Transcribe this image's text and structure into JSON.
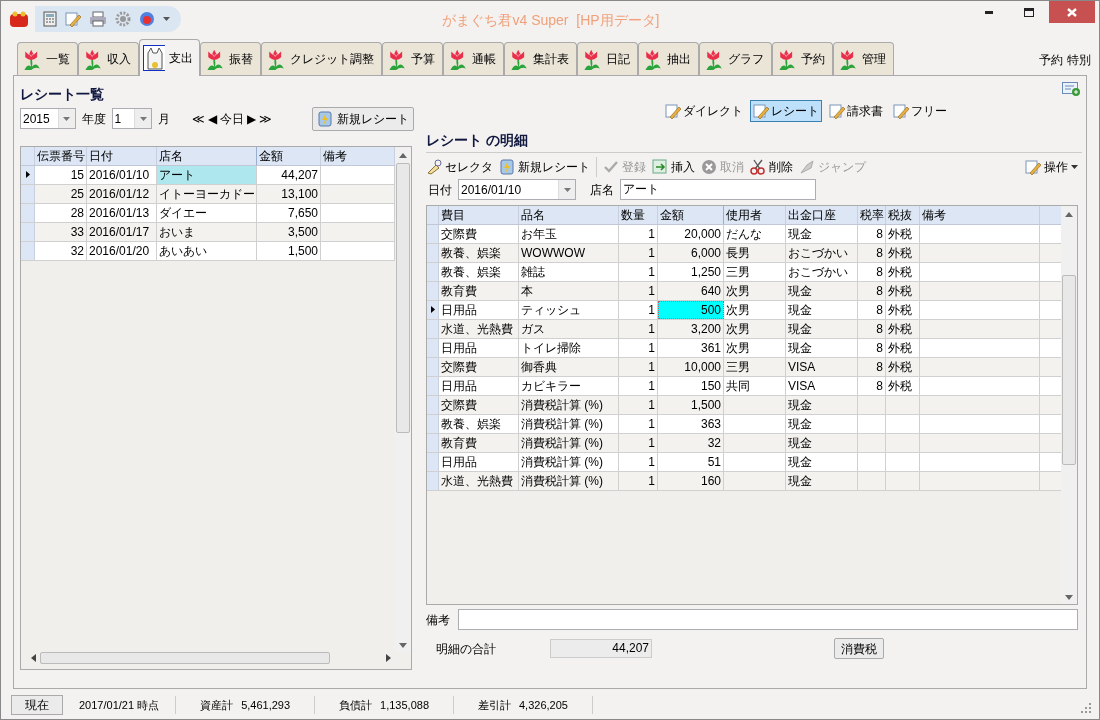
{
  "window": {
    "title": "がまぐち君v4 Super  [HP用データ]"
  },
  "tabs": [
    {
      "label": "一覧",
      "selected": false
    },
    {
      "label": "収入",
      "selected": false
    },
    {
      "label": "支出",
      "selected": true
    },
    {
      "label": "振替",
      "selected": false
    },
    {
      "label": "クレジット調整",
      "selected": false
    },
    {
      "label": "予算",
      "selected": false
    },
    {
      "label": "通帳",
      "selected": false
    },
    {
      "label": "集計表",
      "selected": false
    },
    {
      "label": "日記",
      "selected": false
    },
    {
      "label": "抽出",
      "selected": false
    },
    {
      "label": "グラフ",
      "selected": false
    },
    {
      "label": "予約",
      "selected": false
    },
    {
      "label": "管理",
      "selected": false
    }
  ],
  "side_links": [
    "予約",
    "特別"
  ],
  "receipt_list": {
    "title": "レシート一覧",
    "year": "2015",
    "year_label": "年度",
    "month": "1",
    "month_label": "月",
    "nav": [
      "≪",
      "◀",
      "今日",
      "▶",
      "≫"
    ],
    "new_button": "新規レシート",
    "columns": [
      {
        "label": "伝票番号",
        "kind": "number",
        "focused": false
      },
      {
        "label": "日付",
        "kind": "text",
        "focused": false
      },
      {
        "label": "店名",
        "kind": "text",
        "focused": true
      },
      {
        "label": "金額",
        "kind": "number",
        "focused": false
      },
      {
        "label": "備考",
        "kind": "text",
        "focused": false
      }
    ],
    "rows": [
      {
        "selected": true,
        "cells": [
          "15",
          "2016/01/10",
          "アート",
          "44,207",
          ""
        ]
      },
      {
        "selected": false,
        "cells": [
          "25",
          "2016/01/12",
          "イトーヨーカドー",
          "13,100",
          ""
        ]
      },
      {
        "selected": false,
        "cells": [
          "28",
          "2016/01/13",
          "ダイエー",
          "7,650",
          ""
        ]
      },
      {
        "selected": false,
        "cells": [
          "33",
          "2016/01/17",
          "おいま",
          "3,500",
          ""
        ]
      },
      {
        "selected": false,
        "cells": [
          "32",
          "2016/01/20",
          "あいあい",
          "1,500",
          ""
        ]
      }
    ]
  },
  "view_buttons": [
    {
      "label": "ダイレクト",
      "selected": false
    },
    {
      "label": "レシート",
      "selected": true
    },
    {
      "label": "請求書",
      "selected": false
    },
    {
      "label": "フリー",
      "selected": false
    }
  ],
  "detail": {
    "title": "レシート の明細",
    "toolbar": [
      {
        "label": "セレクタ",
        "disabled": false
      },
      {
        "label": "新規レシート",
        "disabled": false
      },
      {
        "label": "登録",
        "disabled": true
      },
      {
        "label": "挿入",
        "disabled": false
      },
      {
        "label": "取消",
        "disabled": true
      },
      {
        "label": "削除",
        "disabled": false
      },
      {
        "label": "ジャンプ",
        "disabled": true
      }
    ],
    "operations_menu": "操作",
    "date_label": "日付",
    "date": "2016/01/10",
    "store_label": "店名",
    "store": "アート",
    "columns": [
      {
        "label": "費目",
        "kind": "text",
        "focused": false
      },
      {
        "label": "品名",
        "kind": "text",
        "focused": false
      },
      {
        "label": "数量",
        "kind": "number",
        "focused": false
      },
      {
        "label": "金額",
        "kind": "number",
        "focused": true
      },
      {
        "label": "使用者",
        "kind": "text",
        "focused": false
      },
      {
        "label": "出金口座",
        "kind": "text",
        "focused": false
      },
      {
        "label": "税率",
        "kind": "number",
        "focused": false
      },
      {
        "label": "税抜",
        "kind": "text",
        "focused": false
      },
      {
        "label": "備考",
        "kind": "text",
        "focused": false
      }
    ],
    "rows": [
      {
        "selected": false,
        "cells": [
          "交際費",
          "お年玉",
          "1",
          "20,000",
          "だんな",
          "現金",
          "8",
          "外税",
          ""
        ]
      },
      {
        "selected": false,
        "cells": [
          "教養、娯楽",
          "WOWWOW",
          "1",
          "6,000",
          "長男",
          "おこづかい",
          "8",
          "外税",
          ""
        ]
      },
      {
        "selected": false,
        "cells": [
          "教養、娯楽",
          "雑誌",
          "1",
          "1,250",
          "三男",
          "おこづかい",
          "8",
          "外税",
          ""
        ]
      },
      {
        "selected": false,
        "cells": [
          "教育費",
          "本",
          "1",
          "640",
          "次男",
          "現金",
          "8",
          "外税",
          ""
        ]
      },
      {
        "selected": true,
        "cells": [
          "日用品",
          "ティッシュ",
          "1",
          "500",
          "次男",
          "現金",
          "8",
          "外税",
          ""
        ]
      },
      {
        "selected": false,
        "cells": [
          "水道、光熱費",
          "ガス",
          "1",
          "3,200",
          "次男",
          "現金",
          "8",
          "外税",
          ""
        ]
      },
      {
        "selected": false,
        "cells": [
          "日用品",
          "トイレ掃除",
          "1",
          "361",
          "次男",
          "現金",
          "8",
          "外税",
          ""
        ]
      },
      {
        "selected": false,
        "cells": [
          "交際費",
          "御香典",
          "1",
          "10,000",
          "三男",
          "VISA",
          "8",
          "外税",
          ""
        ]
      },
      {
        "selected": false,
        "cells": [
          "日用品",
          "カビキラー",
          "1",
          "150",
          "共同",
          "VISA",
          "8",
          "外税",
          ""
        ]
      },
      {
        "selected": false,
        "cells": [
          "交際費",
          "消費税計算 (%)",
          "1",
          "1,500",
          "",
          "現金",
          "",
          "",
          ""
        ]
      },
      {
        "selected": false,
        "cells": [
          "教養、娯楽",
          "消費税計算 (%)",
          "1",
          "363",
          "",
          "現金",
          "",
          "",
          ""
        ]
      },
      {
        "selected": false,
        "cells": [
          "教育費",
          "消費税計算 (%)",
          "1",
          "32",
          "",
          "現金",
          "",
          "",
          ""
        ]
      },
      {
        "selected": false,
        "cells": [
          "日用品",
          "消費税計算 (%)",
          "1",
          "51",
          "",
          "現金",
          "",
          "",
          ""
        ]
      },
      {
        "selected": false,
        "cells": [
          "水道、光熱費",
          "消費税計算 (%)",
          "1",
          "160",
          "",
          "現金",
          "",
          "",
          ""
        ]
      }
    ],
    "note_label": "備考",
    "total_label": "明細の合計",
    "total": "44,207",
    "tax_button": "消費税"
  },
  "status_bar": {
    "now_button": "現在",
    "as_of": "2017/01/21 時点",
    "items": [
      {
        "label": "資産計",
        "value": "5,461,293"
      },
      {
        "label": "負債計",
        "value": "1,135,088"
      },
      {
        "label": "差引計",
        "value": "4,326,205"
      }
    ]
  }
}
